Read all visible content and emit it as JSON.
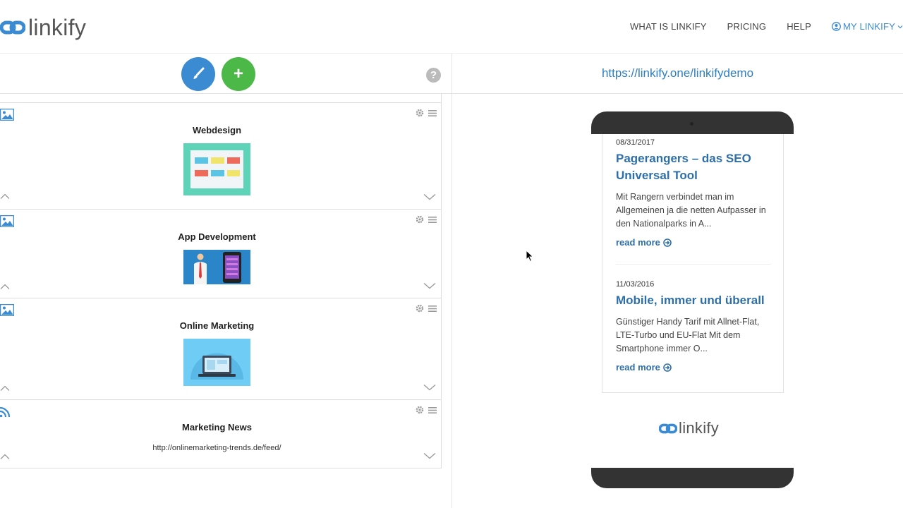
{
  "header": {
    "logo_text": "linkify",
    "nav": [
      {
        "label": "WHAT IS LINKIFY"
      },
      {
        "label": "PRICING"
      },
      {
        "label": "HELP"
      },
      {
        "label": "MY LINKIFY"
      }
    ]
  },
  "toolbar": {
    "design_button_icon": "brush-icon",
    "add_button_icon": "plus-icon",
    "add_button_label": "+",
    "help_icon_label": "?"
  },
  "blocks": [
    {
      "type_icon": "image-icon",
      "title": "Webdesign",
      "thumb": "webdesign"
    },
    {
      "type_icon": "image-icon",
      "title": "App Development",
      "thumb": "app-development"
    },
    {
      "type_icon": "image-icon",
      "title": "Online Marketing",
      "thumb": "online-marketing"
    },
    {
      "type_icon": "rss-icon",
      "title": "Marketing News",
      "feed_url": "http://onlinemarketing-trends.de/feed/"
    }
  ],
  "preview": {
    "url": "https://linkify.one/linkifydemo",
    "news": [
      {
        "date": "08/31/2017",
        "title": "Pagerangers – das SEO Universal Tool",
        "excerpt": "Mit Rangern verbindet man im Allgemeinen ja die netten Aufpasser in den Nationalparks in A...",
        "read_more": "read more"
      },
      {
        "date": "11/03/2016",
        "title": "Mobile, immer und überall",
        "excerpt": " Günstiger Handy Tarif mit Allnet-Flat, LTE-Turbo und EU-Flat Mit dem Smartphone immer O...",
        "read_more": "read more"
      }
    ],
    "footer_logo_text": "linkify"
  },
  "colors": {
    "brand_blue": "#3a8bd1",
    "design_button": "#3a8bd1",
    "add_button": "#4cb848",
    "link_blue": "#2f6fa8",
    "phone_frame": "#333333"
  }
}
